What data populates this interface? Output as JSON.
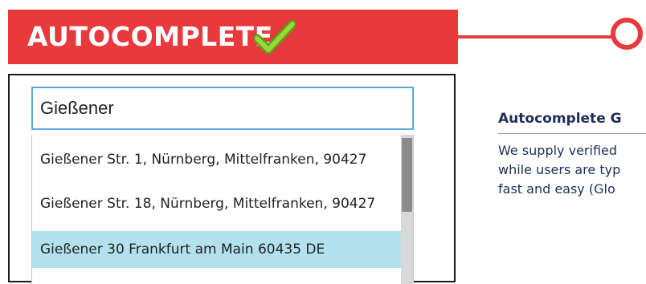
{
  "banner": {
    "title": "AUTOCOMPLETE",
    "check_icon": "checkmark-icon",
    "color": "#e8393d"
  },
  "search": {
    "value": "Gießener",
    "border_color": "#5aa7dd"
  },
  "suggestions": [
    "Gießener Str. 1, Nürnberg, Mittelfranken, 90427",
    "Gießener Str. 18, Nürnberg, Mittelfranken, 90427",
    "Gießener 30 Frankfurt am Main 60435 DE"
  ],
  "selected_index": 2,
  "selected_color": "#b3e2ee",
  "info": {
    "heading": "Autocomplete G",
    "lines": [
      "We supply verified",
      "while users are typ",
      "fast and easy (Glo"
    ]
  }
}
